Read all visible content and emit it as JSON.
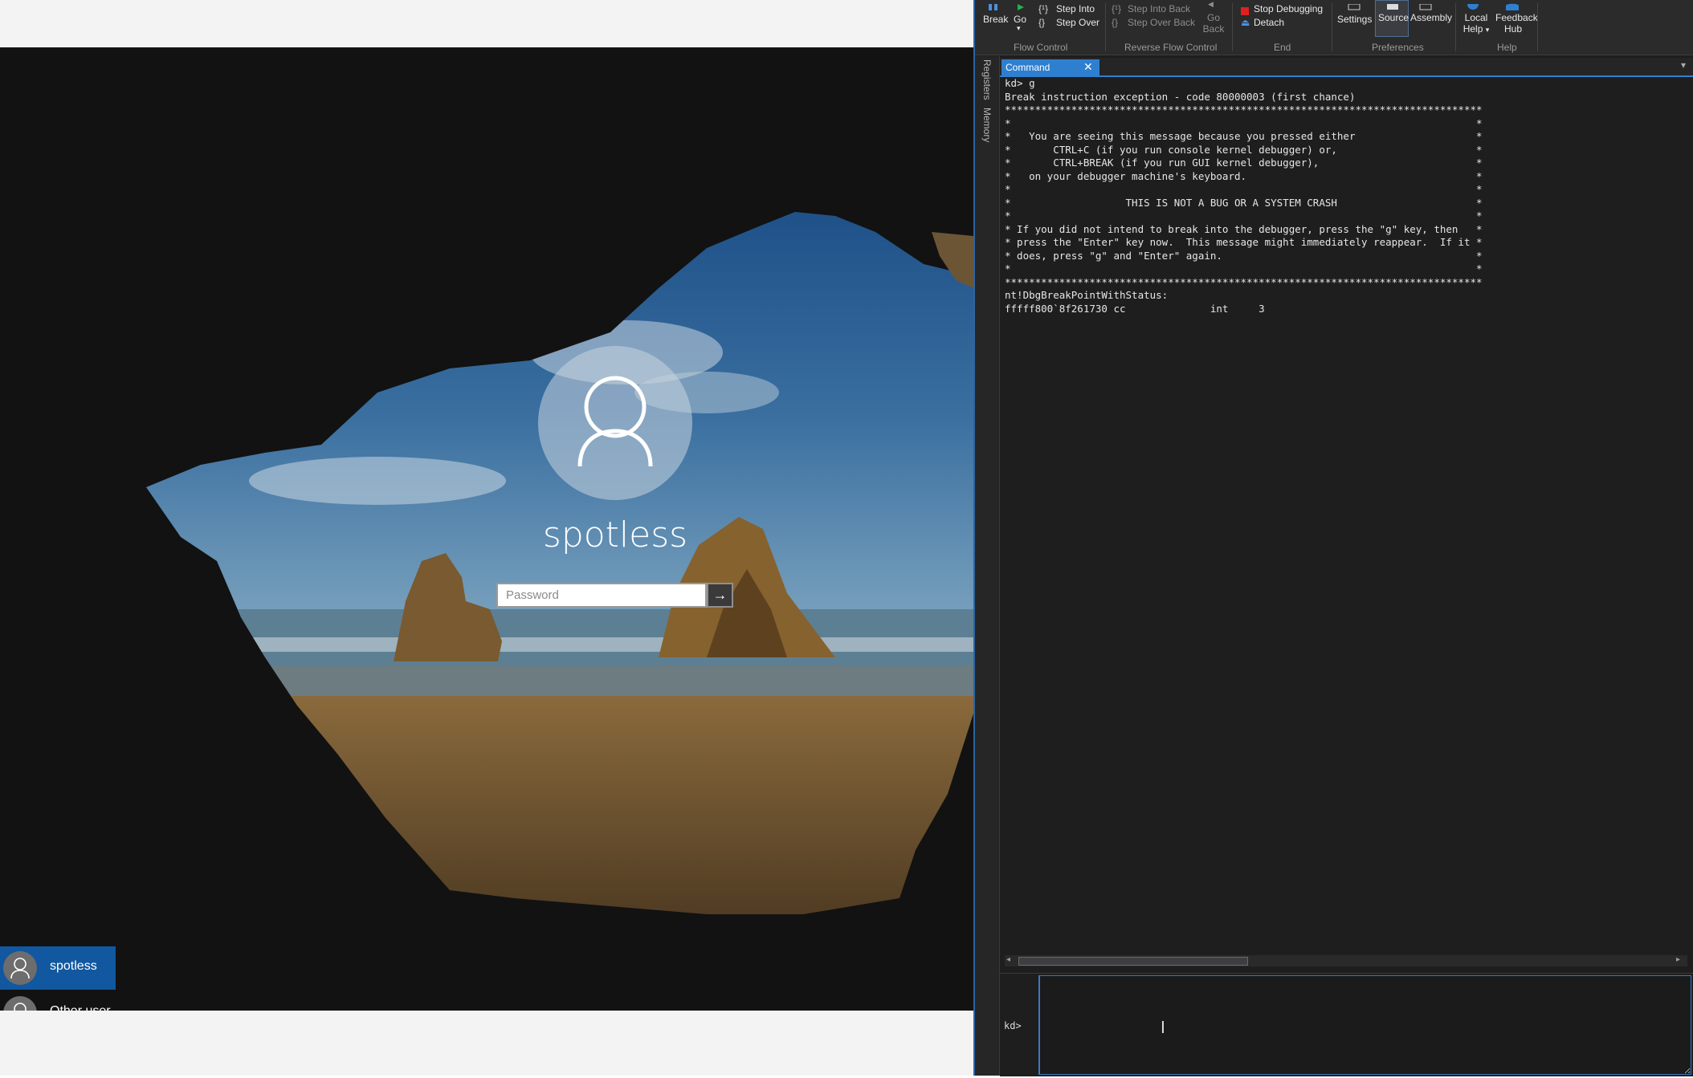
{
  "login": {
    "username": "spotless",
    "password_placeholder": "Password",
    "submit_glyph": "→",
    "users": [
      "spotless",
      "Other user"
    ]
  },
  "ribbon": {
    "flow_control": {
      "break": "Break",
      "go": "Go",
      "step_into": "Step Into",
      "step_over": "Step Over",
      "group": "Flow Control"
    },
    "reverse_flow": {
      "step_into_back": "Step Into Back",
      "step_over_back": "Step Over Back",
      "go_back": "Go Back",
      "group": "Reverse Flow Control"
    },
    "end": {
      "stop_debugging": "Stop Debugging",
      "detach": "Detach",
      "group": "End"
    },
    "preferences": {
      "settings": "Settings",
      "source": "Source",
      "assembly": "Assembly",
      "group": "Preferences"
    },
    "help": {
      "local_help": "Local Help",
      "feedback_hub": "Feedback Hub",
      "group": "Help"
    }
  },
  "side_tabs": [
    "Registers",
    "Memory"
  ],
  "command_window": {
    "tab_title": "Command",
    "prompt": "kd>",
    "output": [
      "kd> g",
      "Break instruction exception - code 80000003 (first chance)",
      "*******************************************************************************",
      "*                                                                             *",
      "*   You are seeing this message because you pressed either                    *",
      "*       CTRL+C (if you run console kernel debugger) or,                       *",
      "*       CTRL+BREAK (if you run GUI kernel debugger),                          *",
      "*   on your debugger machine's keyboard.                                      *",
      "*                                                                             *",
      "*                   THIS IS NOT A BUG OR A SYSTEM CRASH                       *",
      "*                                                                             *",
      "* If you did not intend to break into the debugger, press the \"g\" key, then   *",
      "* press the \"Enter\" key now.  This message might immediately reappear.  If it *",
      "* does, press \"g\" and \"Enter\" again.                                          *",
      "*                                                                             *",
      "*******************************************************************************",
      "nt!DbgBreakPointWithStatus:",
      "fffff800`8f261730 cc              int     3"
    ]
  },
  "colors": {
    "accent": "#2f7fd0",
    "selected_user": "#1158a0",
    "stop_icon": "#e02020",
    "go_icon": "#21b24b"
  },
  "icons": [
    "pause-icon",
    "play-icon",
    "step-into-icon",
    "step-over-icon",
    "step-into-back-icon",
    "step-over-back-icon",
    "go-back-icon",
    "stop-icon",
    "detach-icon",
    "settings-icon",
    "source-icon",
    "assembly-icon",
    "help-icon",
    "feedback-icon",
    "user-icon",
    "arrow-right-icon",
    "close-icon"
  ]
}
